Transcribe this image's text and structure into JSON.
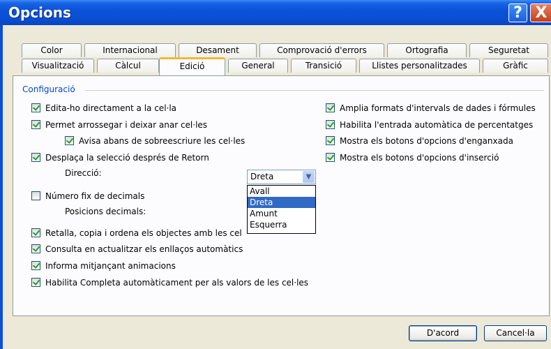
{
  "window": {
    "title": "Opcions",
    "help_glyph": "?",
    "close_glyph": "X"
  },
  "tabs_row1": [
    "Color",
    "Internacional",
    "Desament",
    "Comprovació d'errors",
    "Ortografia",
    "Seguretat"
  ],
  "tabs_row2": [
    "Visualització",
    "Càlcul",
    "Edició",
    "General",
    "Transició",
    "Llistes personalitzades",
    "Gràfic"
  ],
  "active_tab": "Edició",
  "group": {
    "title": "Configuració"
  },
  "left_options": {
    "edit_directly": {
      "label": "Edita-ho directament a la cel·la",
      "checked": true
    },
    "drag_drop": {
      "label": "Permet arrossegar i deixar anar cel·les",
      "checked": true
    },
    "alert_overwrite": {
      "label": "Avisa abans de sobreescriure les cel·les",
      "checked": true
    },
    "move_after_enter": {
      "label": "Desplaça la selecció després de Retorn",
      "checked": true
    },
    "direction_label": "Direcció:",
    "fixed_decimal": {
      "label": "Número fix de decimals",
      "checked": false
    },
    "places_label": "Posicions decimals:",
    "cut_copy_sort": {
      "label": "Retalla, copia i ordena els objectes amb les cel",
      "checked": true
    },
    "ask_update_links": {
      "label": "Consulta en actualitzar els enllaços automàtics",
      "checked": true
    },
    "animations": {
      "label": "Informa mitjançant animacions",
      "checked": true
    },
    "autocomplete": {
      "label": "Habilita Completa automàticament per als valors de les cel·les",
      "checked": true
    }
  },
  "right_options": {
    "extend_formats": {
      "label": "Amplia formats d'intervals de dades i fórmules",
      "checked": true
    },
    "auto_percent": {
      "label": "Habilita l'entrada automàtica de percentatges",
      "checked": true
    },
    "paste_options": {
      "label": "Mostra els botons d'opcions d'enganxada",
      "checked": true
    },
    "insert_options": {
      "label": "Mostra els botons d'opcions d'inserció",
      "checked": true
    }
  },
  "direction": {
    "value": "Dreta",
    "options": [
      "Avall",
      "Dreta",
      "Amunt",
      "Esquerra"
    ],
    "selected_index": 1
  },
  "buttons": {
    "ok": "D'acord",
    "cancel": "Cancel·la"
  }
}
